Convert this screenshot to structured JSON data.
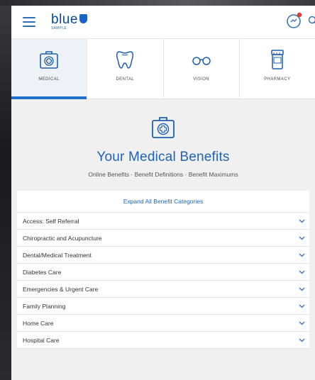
{
  "header": {
    "logo_text": "blue",
    "logo_sub": "SAMPLE"
  },
  "tabs": [
    {
      "label": "MEDICAL",
      "icon": "medical-kit-icon",
      "active": true
    },
    {
      "label": "DENTAL",
      "icon": "tooth-icon",
      "active": false
    },
    {
      "label": "VISION",
      "icon": "glasses-icon",
      "active": false
    },
    {
      "label": "PHARMACY",
      "icon": "pharmacy-bottle-icon",
      "active": false
    }
  ],
  "hero": {
    "title": "Your Medical Benefits",
    "sub_link1": "Online Benefits",
    "sub_sep1": " · ",
    "sub_link2": "Benefit Definitions",
    "sub_sep2": " · ",
    "sub_link3": "Benefit Maximums"
  },
  "categories": {
    "expand_label": "Expand All Benefit Categories",
    "items": [
      "Access: Self Referral",
      "Chiropractic and Acupuncture",
      "Dental/Medical Treatment",
      "Diabetes Care",
      "Emergencies & Urgent Care",
      "Family Planning",
      "Home Care",
      "Hospital Care"
    ]
  },
  "colors": {
    "accent": "#1f6fc9",
    "title_blue": "#1f63b8",
    "notification_red": "#e53935"
  }
}
